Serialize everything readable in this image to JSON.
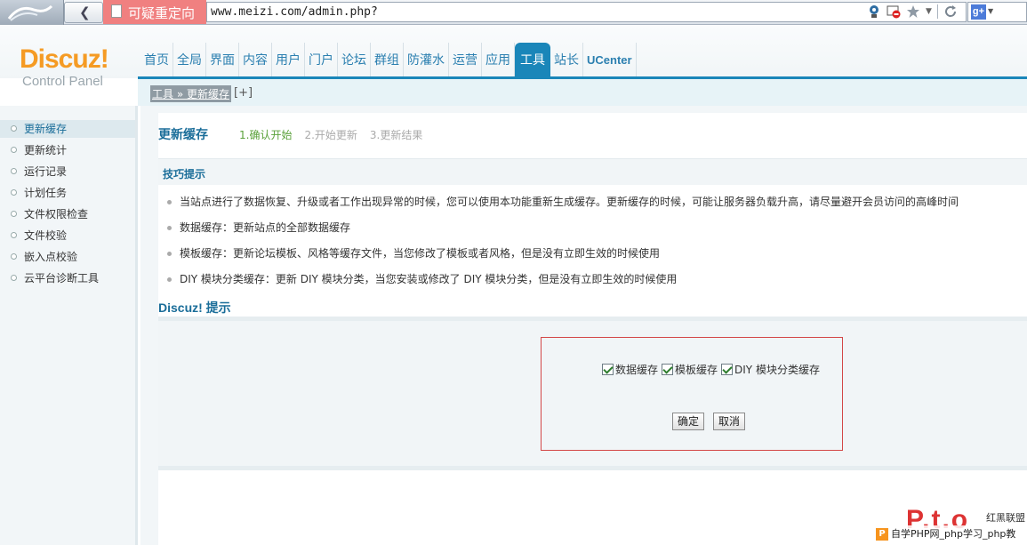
{
  "browser": {
    "redirect_label": "可疑重定向",
    "url": "www.meizi.com/admin.php?"
  },
  "brand": {
    "name": "Discuz!",
    "subtitle": "Control Panel"
  },
  "nav": {
    "items": [
      "首页",
      "全局",
      "界面",
      "内容",
      "用户",
      "门户",
      "论坛",
      "群组",
      "防灌水",
      "运营",
      "应用",
      "工具",
      "站长",
      "UCenter"
    ],
    "active": "工具"
  },
  "breadcrumb": {
    "text": "工具 » 更新缓存",
    "plus": "[+]"
  },
  "sidebar": {
    "items": [
      "更新缓存",
      "更新统计",
      "运行记录",
      "计划任务",
      "文件权限检查",
      "文件校验",
      "嵌入点校验",
      "云平台诊断工具"
    ]
  },
  "main": {
    "title": "更新缓存",
    "steps": [
      "1.确认开始",
      "2.开始更新",
      "3.更新结果"
    ],
    "tips_title": "技巧提示",
    "tips": [
      "当站点进行了数据恢复、升级或者工作出现异常的时候，您可以使用本功能重新生成缓存。更新缓存的时候，可能让服务器负载升高，请尽量避开会员访问的高峰时间",
      "数据缓存：更新站点的全部数据缓存",
      "模板缓存：更新论坛模板、风格等缓存文件，当您修改了模板或者风格，但是没有立即生效的时候使用",
      "DIY 模块分类缓存：更新 DIY 模块分类，当您安装或修改了 DIY 模块分类，但是没有立即生效的时候使用"
    ],
    "discuz_tip_title": "Discuz! 提示",
    "checkboxes": [
      {
        "label": "数据缓存",
        "checked": true
      },
      {
        "label": "模板缓存",
        "checked": true
      },
      {
        "label": "DIY 模块分类缓存",
        "checked": true
      }
    ],
    "confirm_label": "确定",
    "cancel_label": "取消"
  },
  "watermark": {
    "logo_text": "P.t.o",
    "brand_small": "红黑联盟",
    "strip_text": "自学PHP网_php学习_php教"
  },
  "colors": {
    "accent": "#1a86b9",
    "brand_orange": "#f59b24",
    "redirect": "#f08080",
    "dialog_border": "#d34747"
  }
}
